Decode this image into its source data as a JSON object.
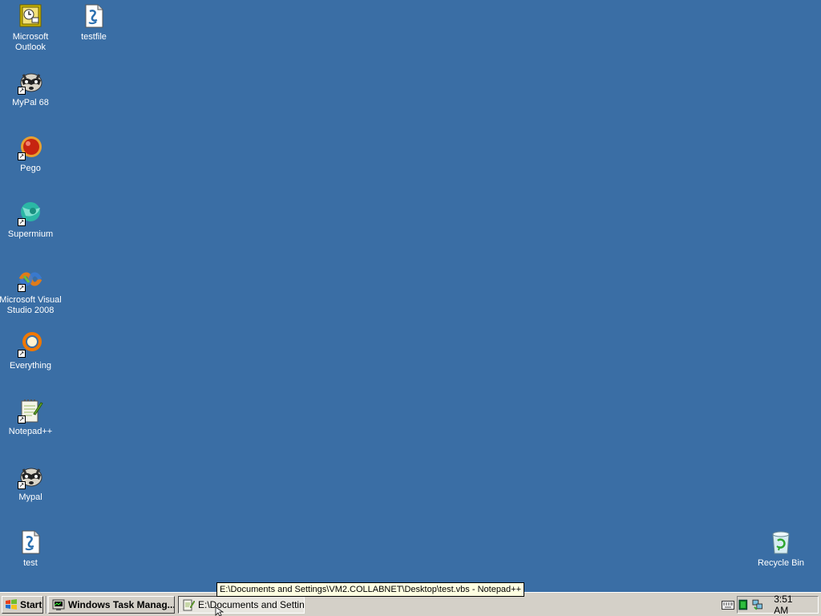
{
  "desktop": {
    "background_color": "#3a6ea5",
    "icons": [
      {
        "label": "Microsoft Outlook",
        "icon": "outlook-icon",
        "shortcut": false
      },
      {
        "label": "testfile",
        "icon": "vbs-script-icon",
        "shortcut": false
      },
      {
        "label": "MyPal 68",
        "icon": "mypal-raccoon-icon",
        "shortcut": true
      },
      {
        "label": "Pego",
        "icon": "pego-ball-icon",
        "shortcut": true
      },
      {
        "label": "Supermium",
        "icon": "supermium-icon",
        "shortcut": true
      },
      {
        "label": "Microsoft Visual Studio 2008",
        "icon": "visual-studio-icon",
        "shortcut": true
      },
      {
        "label": "Everything",
        "icon": "everything-search-icon",
        "shortcut": true
      },
      {
        "label": "Notepad++",
        "icon": "notepadpp-icon",
        "shortcut": true
      },
      {
        "label": "Mypal",
        "icon": "mypal-raccoon-icon",
        "shortcut": true
      },
      {
        "label": "test",
        "icon": "vbs-script-icon",
        "shortcut": false
      },
      {
        "label": "Recycle Bin",
        "icon": "recycle-bin-icon",
        "shortcut": false
      }
    ]
  },
  "tooltip": {
    "text": "E:\\Documents and Settings\\VM2.COLLABNET\\Desktop\\test.vbs - Notepad++"
  },
  "taskbar": {
    "start_label": "Start",
    "tasks": [
      {
        "label": "Windows Task Manag...",
        "icon": "task-manager-icon",
        "active": false
      },
      {
        "label": "E:\\Documents and Settin...",
        "icon": "notepadpp-icon",
        "active": true
      }
    ],
    "tray": {
      "icons": [
        "keyboard-icon",
        "green-status-icon",
        "network-icon"
      ],
      "clock": "3:51 AM"
    }
  }
}
